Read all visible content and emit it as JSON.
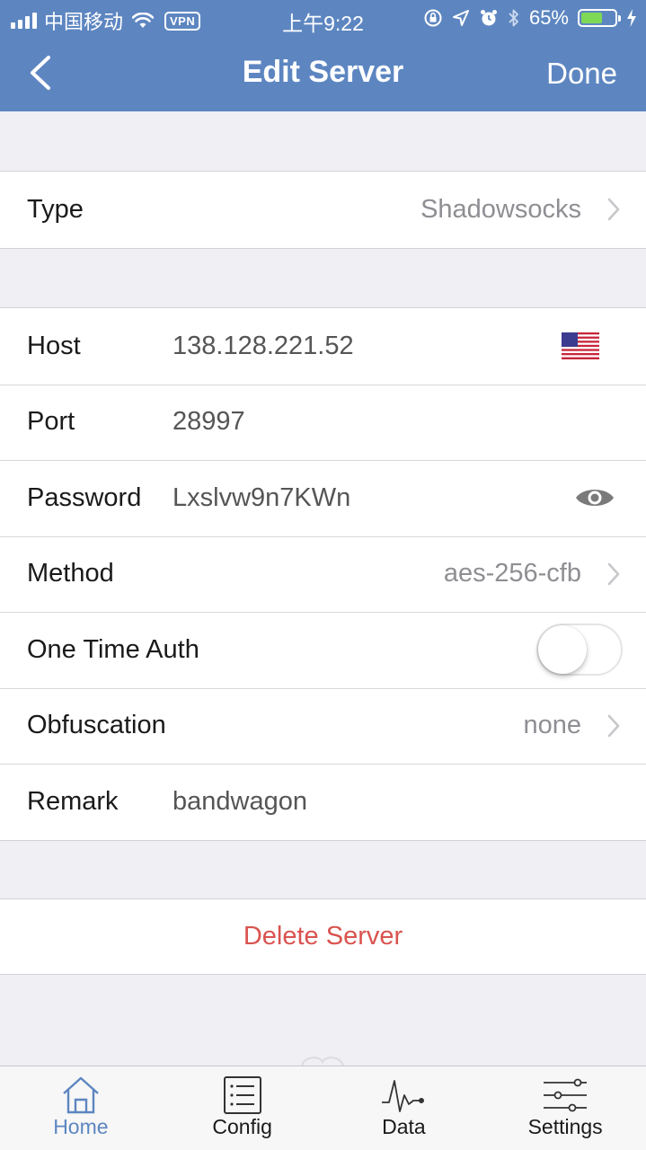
{
  "status_bar": {
    "carrier": "中国移动",
    "vpn": "VPN",
    "time": "上午9:22",
    "battery_percent": "65%",
    "battery_level": 0.65
  },
  "nav": {
    "title": "Edit Server",
    "done_label": "Done"
  },
  "type_row": {
    "label": "Type",
    "value": "Shadowsocks"
  },
  "server": {
    "host": {
      "label": "Host",
      "value": "138.128.221.52"
    },
    "port": {
      "label": "Port",
      "value": "28997"
    },
    "password": {
      "label": "Password",
      "value": "Lxslvw9n7KWn"
    },
    "method": {
      "label": "Method",
      "value": "aes-256-cfb"
    },
    "one_time_auth": {
      "label": "One Time Auth",
      "enabled": false
    },
    "obfuscation": {
      "label": "Obfuscation",
      "value": "none"
    },
    "remark": {
      "label": "Remark",
      "value": "bandwagon"
    }
  },
  "delete_label": "Delete Server",
  "tabs": [
    {
      "label": "Home",
      "active": true
    },
    {
      "label": "Config",
      "active": false
    },
    {
      "label": "Data",
      "active": false
    },
    {
      "label": "Settings",
      "active": false
    }
  ],
  "colors": {
    "header": "#5d86c1",
    "accent": "#5d86c1",
    "destructive": "#d9534f",
    "background": "#efeff4"
  }
}
